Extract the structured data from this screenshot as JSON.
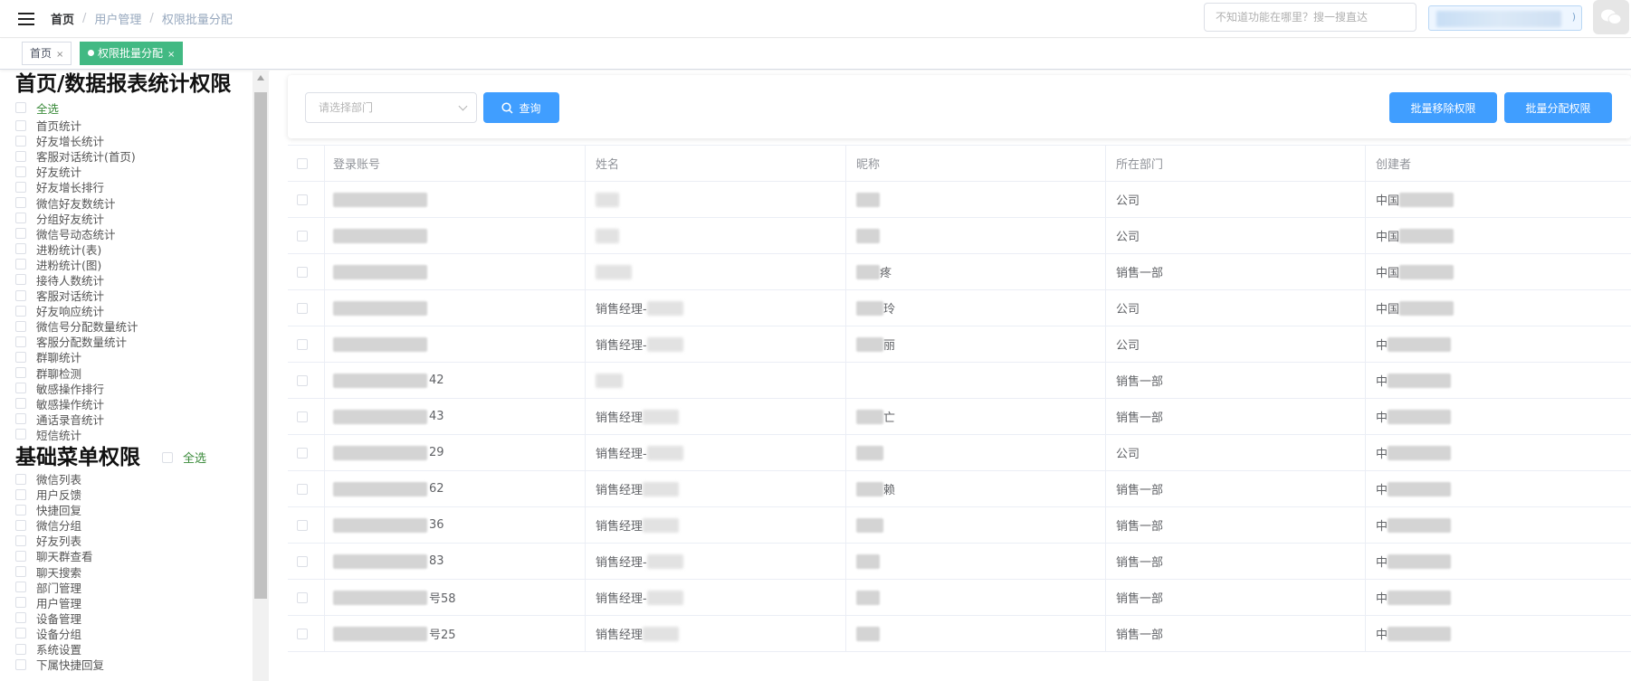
{
  "header": {
    "breadcrumb": [
      "首页",
      "用户管理",
      "权限批量分配"
    ],
    "breadcrumb_sep": "/",
    "search_placeholder": "不知道功能在哪里？搜一搜直达",
    "user_pill_tail": ")"
  },
  "tags": [
    {
      "label": "首页",
      "close": "×"
    },
    {
      "label": "权限批量分配",
      "close": "×"
    }
  ],
  "left": {
    "section1_title": "首页/数据报表统计权限",
    "select_all": "全选",
    "section1_items": [
      "首页统计",
      "好友增长统计",
      "客服对话统计(首页)",
      "好友统计",
      "好友增长排行",
      "微信好友数统计",
      "分组好友统计",
      "微信号动态统计",
      "进粉统计(表)",
      "进粉统计(图)",
      "接待人数统计",
      "客服对话统计",
      "好友响应统计",
      "微信号分配数量统计",
      "客服分配数量统计",
      "群聊统计",
      "群聊检测",
      "敏感操作排行",
      "敏感操作统计",
      "通话录音统计",
      "短信统计"
    ],
    "section2_title": "基础菜单权限",
    "section2_items": [
      "微信列表",
      "用户反馈",
      "快捷回复",
      "微信分组",
      "好友列表",
      "聊天群查看",
      "聊天搜索",
      "部门管理",
      "用户管理",
      "设备管理",
      "设备分组",
      "系统设置",
      "下属快捷回复"
    ]
  },
  "toolbar": {
    "dept_placeholder": "请选择部门",
    "query_label": "查询",
    "remove_label": "批量移除权限",
    "assign_label": "批量分配权限"
  },
  "table": {
    "columns": [
      "登录账号",
      "姓名",
      "昵称",
      "所在部门",
      "创建者"
    ],
    "rows": [
      {
        "account": "",
        "name": "",
        "nick": "",
        "dept": "公司",
        "creator": "中国"
      },
      {
        "account": "",
        "name": "",
        "nick": "",
        "dept": "公司",
        "creator": "中国"
      },
      {
        "account": "",
        "name": "",
        "nick": "疼",
        "dept": "销售一部",
        "creator": "中国"
      },
      {
        "account": "",
        "name": "销售经理-",
        "nick": "玲",
        "dept": "公司",
        "creator": "中国"
      },
      {
        "account": "",
        "name": "销售经理-",
        "nick": "丽",
        "dept": "公司",
        "creator": "中"
      },
      {
        "account": "42",
        "name": "",
        "nick": "",
        "dept": "销售一部",
        "creator": "中"
      },
      {
        "account": "43",
        "name": "销售经理",
        "nick": "亡",
        "dept": "销售一部",
        "creator": "中"
      },
      {
        "account": "29",
        "name": "销售经理-",
        "nick": "",
        "dept": "公司",
        "creator": "中"
      },
      {
        "account": "62",
        "name": "销售经理",
        "nick": "赖",
        "dept": "销售一部",
        "creator": "中"
      },
      {
        "account": "36",
        "name": "销售经理",
        "nick": "",
        "dept": "销售一部",
        "creator": "中"
      },
      {
        "account": "83",
        "name": "销售经理-",
        "nick": "",
        "dept": "销售一部",
        "creator": "中"
      },
      {
        "account": "号58",
        "name": "销售经理-",
        "nick": "",
        "dept": "销售一部",
        "creator": "中"
      },
      {
        "account": "号25",
        "name": "销售经理",
        "nick": "",
        "dept": "销售一部",
        "creator": "中"
      }
    ]
  },
  "colors": {
    "accent": "#409eff",
    "tag_active": "#42b983",
    "select_all_text": "#3a8a3a"
  }
}
